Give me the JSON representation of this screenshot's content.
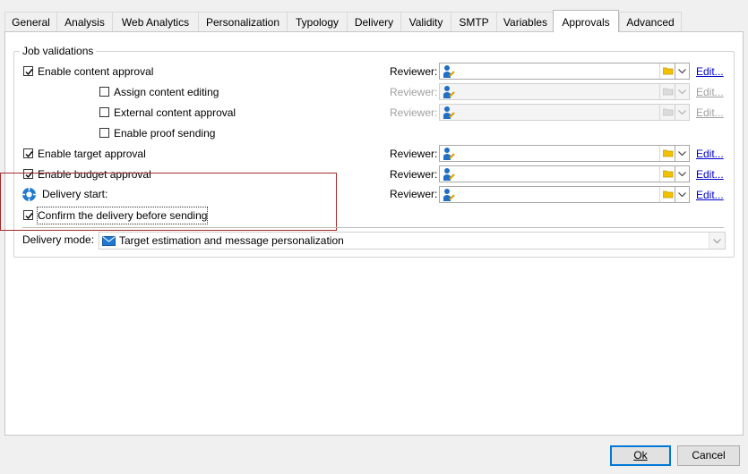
{
  "tabs": [
    {
      "label": "General"
    },
    {
      "label": "Analysis"
    },
    {
      "label": "Web Analytics"
    },
    {
      "label": "Personalization"
    },
    {
      "label": "Typology"
    },
    {
      "label": "Delivery"
    },
    {
      "label": "Validity"
    },
    {
      "label": "SMTP"
    },
    {
      "label": "Variables"
    },
    {
      "label": "Approvals",
      "active": true
    },
    {
      "label": "Advanced"
    }
  ],
  "group": {
    "title": "Job validations",
    "rows": [
      {
        "label": "Enable content approval",
        "checked": true,
        "reviewer_label": "Reviewer:",
        "edit_label": "Edit...",
        "enabled": true
      },
      {
        "label": "Assign content editing",
        "checked": false,
        "reviewer_label": "Reviewer:",
        "edit_label": "Edit...",
        "enabled": false
      },
      {
        "label": "External content approval",
        "checked": false,
        "reviewer_label": "Reviewer:",
        "edit_label": "Edit...",
        "enabled": false
      },
      {
        "label": "Enable proof sending",
        "checked": false
      },
      {
        "label": "Enable target approval",
        "checked": true,
        "reviewer_label": "Reviewer:",
        "edit_label": "Edit...",
        "enabled": true
      },
      {
        "label": "Enable budget approval",
        "checked": true,
        "reviewer_label": "Reviewer:",
        "edit_label": "Edit...",
        "enabled": true
      },
      {
        "label": "Delivery start:",
        "reviewer_label": "Reviewer:",
        "edit_label": "Edit...",
        "enabled": true
      },
      {
        "label": "Confirm the delivery before sending",
        "checked": true
      }
    ]
  },
  "delivery_mode": {
    "label": "Delivery mode:",
    "value": "Target estimation and message personalization"
  },
  "buttons": {
    "ok_label": "Ok",
    "cancel_label": "Cancel"
  },
  "colors": {
    "highlight_box": "#a52a2a",
    "link": "#0000cc",
    "primary_border": "#0078d7"
  },
  "icons": {
    "reviewer": "person-icon",
    "folder": "folder-icon",
    "dropdown": "chevron-down-icon",
    "delivery_start": "delivery-start-icon",
    "delivery_mode": "envelope-icon"
  }
}
